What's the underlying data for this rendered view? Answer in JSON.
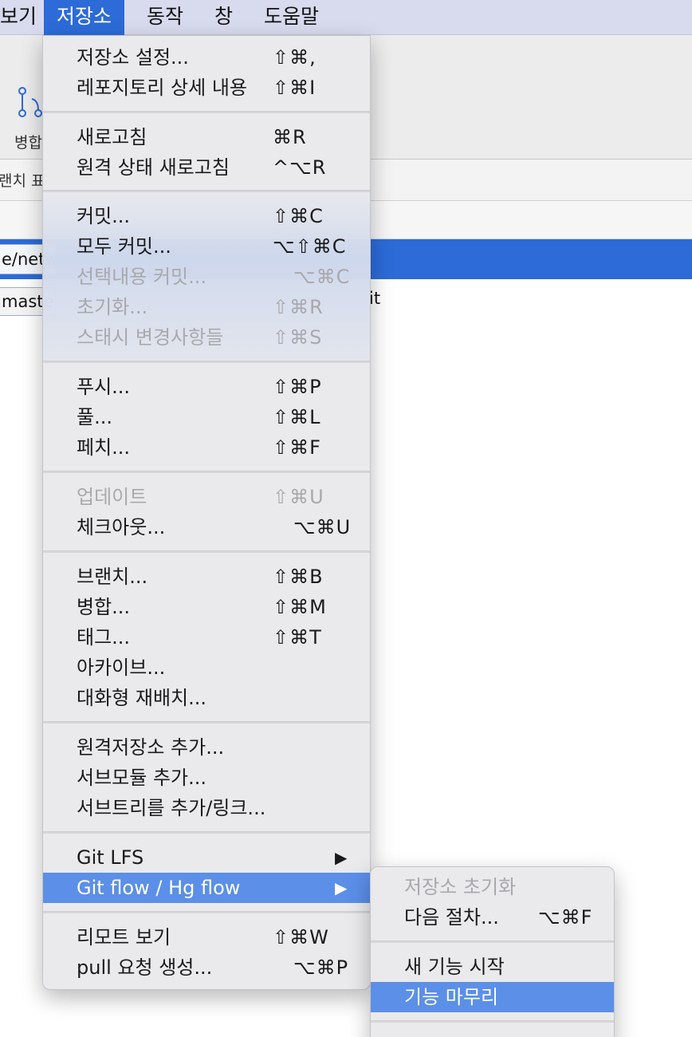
{
  "menubar": {
    "items": [
      {
        "label": "보기"
      },
      {
        "label": "저장소"
      },
      {
        "label": "동작"
      },
      {
        "label": "창"
      },
      {
        "label": "도움말"
      }
    ]
  },
  "background": {
    "toolbar_label": "병합",
    "tab_label": "랜치 표",
    "path_text": "e/netw",
    "branch_text": "maste",
    "row_tail": "it"
  },
  "repository_menu": {
    "items": [
      {
        "label": "저장소 설정...",
        "shortcut": "⇧⌘,",
        "disabled": false
      },
      {
        "label": "레포지토리 상세 내용",
        "shortcut": "⇧⌘I",
        "disabled": false
      },
      {
        "label": "새로고침",
        "shortcut": "⌘R",
        "disabled": false
      },
      {
        "label": "원격 상태 새로고침",
        "shortcut": "^⌥R",
        "disabled": false
      },
      {
        "label": "커밋...",
        "shortcut": "⇧⌘C",
        "disabled": false
      },
      {
        "label": "모두 커밋...",
        "shortcut": "⌥⇧⌘C",
        "disabled": false
      },
      {
        "label": "선택내용 커밋...",
        "shortcut": "⌥⌘C",
        "disabled": true
      },
      {
        "label": "초기화...",
        "shortcut": "⇧⌘R",
        "disabled": true
      },
      {
        "label": "스태시  변경사항들",
        "shortcut": "⇧⌘S",
        "disabled": true
      },
      {
        "label": "푸시...",
        "shortcut": "⇧⌘P",
        "disabled": false
      },
      {
        "label": "풀...",
        "shortcut": "⇧⌘L",
        "disabled": false
      },
      {
        "label": "페치...",
        "shortcut": "⇧⌘F",
        "disabled": false
      },
      {
        "label": "업데이트",
        "shortcut": "⇧⌘U",
        "disabled": true
      },
      {
        "label": "체크아웃...",
        "shortcut": "⌥⌘U",
        "disabled": false
      },
      {
        "label": "브랜치...",
        "shortcut": "⇧⌘B",
        "disabled": false
      },
      {
        "label": "병합...",
        "shortcut": "⇧⌘M",
        "disabled": false
      },
      {
        "label": "태그...",
        "shortcut": "⇧⌘T",
        "disabled": false
      },
      {
        "label": "아카이브...",
        "shortcut": "",
        "disabled": false
      },
      {
        "label": "대화형 재배치...",
        "shortcut": "",
        "disabled": false
      },
      {
        "label": "원격저장소 추가...",
        "shortcut": "",
        "disabled": false
      },
      {
        "label": "서브모듈 추가...",
        "shortcut": "",
        "disabled": false
      },
      {
        "label": "서브트리를 추가/링크...",
        "shortcut": "",
        "disabled": false
      },
      {
        "label": "Git LFS",
        "shortcut": "▶",
        "disabled": false
      },
      {
        "label": "Git flow / Hg flow",
        "shortcut": "▶",
        "disabled": false,
        "highlighted": true
      },
      {
        "label": "리모트 보기",
        "shortcut": "⇧⌘W",
        "disabled": false
      },
      {
        "label": "pull 요청 생성...",
        "shortcut": "⌥⌘P",
        "disabled": false
      }
    ]
  },
  "git_flow_submenu": {
    "items": [
      {
        "label": "저장소 초기화",
        "shortcut": "",
        "disabled": true
      },
      {
        "label": "다음 절차...",
        "shortcut": "⌥⌘F",
        "disabled": false
      },
      {
        "label": "새 기능 시작",
        "shortcut": "",
        "disabled": false
      },
      {
        "label": "기능 마무리",
        "shortcut": "",
        "disabled": false,
        "highlighted": true
      }
    ]
  },
  "colors": {
    "accent": "#2c6bd8",
    "highlight": "#5b8fe8",
    "menubar": "#d8dbee",
    "disabled_text": "#a9a9ad"
  }
}
